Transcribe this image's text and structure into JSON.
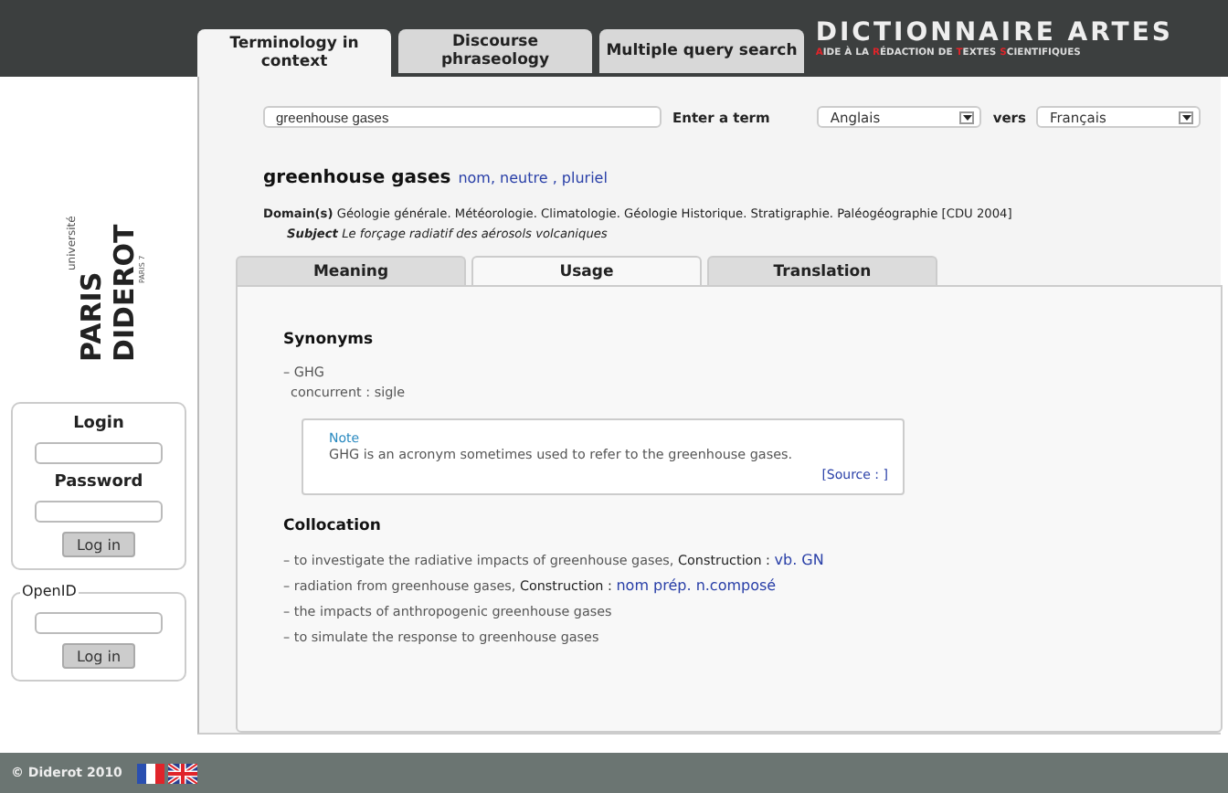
{
  "header": {
    "title": "DICTIONNAIRE ARTES",
    "subtitle": [
      {
        "word": "AIDE",
        "highlight": true
      },
      {
        "word": "À",
        "highlight": false
      },
      {
        "word": "LA",
        "highlight": false
      },
      {
        "word": "RÉDACTION",
        "highlight": true
      },
      {
        "word": "DE",
        "highlight": false
      },
      {
        "word": "TEXTES",
        "highlight": true
      },
      {
        "word": "SCIENTIFIQUES",
        "highlight": true
      }
    ]
  },
  "tabs": [
    {
      "label": "Terminology in context",
      "selected": true
    },
    {
      "label": "Discourse phraseology",
      "selected": false
    },
    {
      "label": "Multiple query search",
      "selected": false
    }
  ],
  "logo": {
    "top": "université",
    "line1": "PARIS",
    "line2": "DIDEROT",
    "bottom": "PARIS 7"
  },
  "login": {
    "login_label": "Login",
    "password_label": "Password",
    "button": "Log in"
  },
  "openid": {
    "legend": "OpenID",
    "button": "Log in"
  },
  "search": {
    "value": "greenhouse gases",
    "label": "Enter a term",
    "source": "Anglais",
    "vers": "vers",
    "target": "Français"
  },
  "entry": {
    "term": "greenhouse gases",
    "grammar": "nom, neutre , pluriel",
    "domain_label": "Domain(s)",
    "domain": "Géologie générale. Météorologie. Climatologie. Géologie Historique. Stratigraphie. Paléogéographie [CDU 2004]",
    "subject_label": "Subject",
    "subject": "Le forçage radiatif des aérosols volcaniques"
  },
  "inner_tabs": [
    {
      "label": "Meaning",
      "selected": false
    },
    {
      "label": "Usage",
      "selected": true
    },
    {
      "label": "Translation",
      "selected": false
    }
  ],
  "synonyms": {
    "heading": "Synonyms",
    "term": "– GHG",
    "detail": "concurrent : sigle"
  },
  "note": {
    "title": "Note",
    "text": "GHG is an acronym sometimes used to refer to the greenhouse gases.",
    "source": "[Source : ]"
  },
  "collocation": {
    "heading": "Collocation",
    "items": [
      {
        "text": "– to investigate the radiative impacts of greenhouse gases,",
        "construction_label": "Construction :",
        "construction": "vb. GN"
      },
      {
        "text": "– radiation from greenhouse gases,",
        "construction_label": "Construction :",
        "construction": "nom prép. n.composé"
      },
      {
        "text": "– the impacts of anthropogenic greenhouse gases"
      },
      {
        "text": "– to simulate the response to greenhouse gases"
      }
    ]
  },
  "footer": {
    "copyright": "© Diderot 2010"
  }
}
